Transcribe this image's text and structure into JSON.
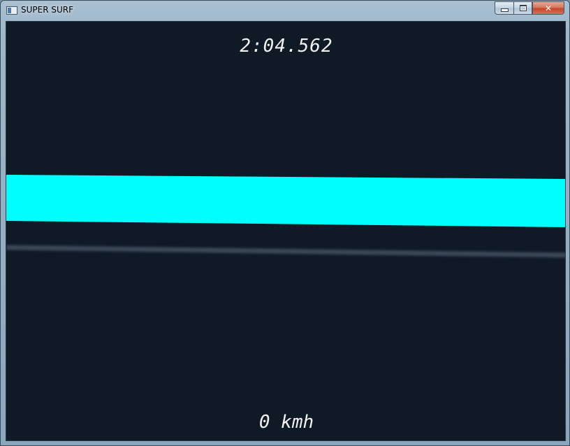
{
  "window": {
    "title": "SUPER SURF",
    "close_glyph": "✕"
  },
  "game": {
    "timer": "2:04.562",
    "speed_value": "0",
    "speed_unit": "kmh"
  },
  "colors": {
    "background": "#101a27",
    "track_band": "#00ffff",
    "track_line": "#3a4756",
    "hud_text": "#f2f2f2"
  }
}
